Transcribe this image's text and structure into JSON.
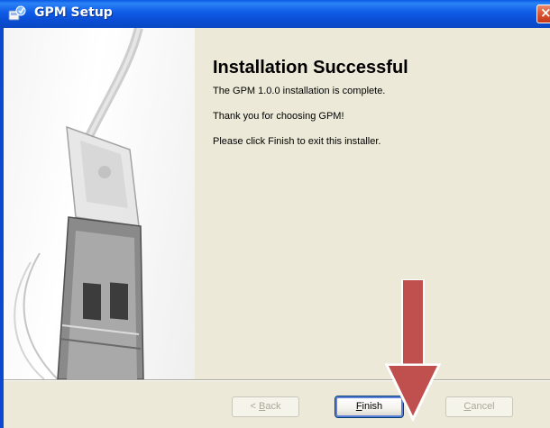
{
  "window": {
    "title": "GPM Setup",
    "close_glyph": "×"
  },
  "side_image": {
    "description_icon": "usb-connector-icon"
  },
  "page": {
    "heading": "Installation Successful",
    "line1": "The GPM 1.0.0 installation is complete.",
    "line2": "Thank you for choosing GPM!",
    "line3": "Please click Finish to exit this installer."
  },
  "buttons": {
    "back": {
      "accel": "B",
      "rest": "ack",
      "prefix": "< ",
      "enabled": false
    },
    "finish": {
      "accel": "F",
      "rest": "inish",
      "enabled": true,
      "default": true
    },
    "cancel": {
      "accel": "C",
      "rest": "ancel",
      "enabled": false
    }
  },
  "annotation": {
    "arrow_color": "#C0504D",
    "arrow_icon": "down-arrow-icon"
  },
  "colors": {
    "titlebar": "#0A5AE3",
    "face": "#ECE9D8",
    "close": "#D9542F"
  }
}
